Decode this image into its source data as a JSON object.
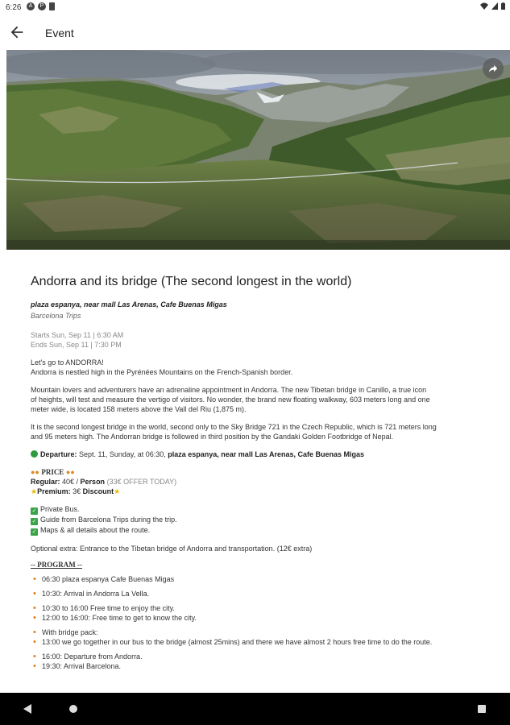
{
  "status": {
    "time": "6:26"
  },
  "app_bar": {
    "title": "Event"
  },
  "event": {
    "title": "Andorra and its bridge (The second longest in the world)",
    "venue": "plaza espanya, near mall Las Arenas, Cafe Buenas Migas",
    "organizer": "Barcelona Trips",
    "starts": "Starts Sun, Sep 11 | 6:30 AM",
    "ends": "Ends Sun, Sep 11 | 7:30 PM"
  },
  "description": {
    "intro_1": "Let's go to ANDORRA!",
    "intro_2": "Andorra is nestled high in the Pyrénées Mountains on the French-Spanish border.",
    "para_2a": "Mountain lovers and adventurers have an adrenaline appointment in Andorra. The new Tibetan bridge in Canillo, a true icon",
    "para_2b": "of heights, will test and measure the vertigo of visitors. No wonder, the brand new floating walkway, 603 meters long and one",
    "para_2c": "meter wide, is located 158 meters above the Vall del Riu (1,875 m).",
    "para_3a": "It is the second longest bridge in the world, second only to the Sky Bridge 721 in the Czech Republic, which is 721 meters long",
    "para_3b": "and 95 meters high. The Andorran bridge is followed in third position by the Gandaki Golden Footbridge of Nepal.",
    "departure_label": "Departure:",
    "departure_text": " Sept. 11, Sunday, at 06:30, ",
    "departure_place": "plaza espanya, near mall Las Arenas, Cafe Buenas Migas",
    "price_heading": "PRICE",
    "regular_label": "Regular:",
    "regular_value": " 40€ / ",
    "regular_person": "Person",
    "regular_offer": " (33€ OFFER TODAY)",
    "premium_label": "Premium:",
    "premium_value": " 3€ ",
    "premium_discount": "Discount",
    "included": [
      "Private Bus.",
      "Guide from Barcelona Trips during the trip.",
      "Maps & all details about the route."
    ],
    "optional_extra": "Optional extra:  Entrance to the Tibetan bridge of Andorra and transportation. (12€ extra)",
    "program_heading": "-- PROGRAM --",
    "program": [
      "06:30 plaza espanya Cafe Buenas Migas",
      "10:30: Arrival in Andorra La Vella.",
      "10:30 to 16:00 Free time to enjoy the city.",
      "12:00 to 16:00: Free time to get to know the city.",
      "With bridge pack:",
      "13:00 we go together in our bus to the bridge (almost 25mins) and there we have almost 2 hours free time to do the route.",
      "16:00: Departure from Andorra.",
      "19:30: Arrival Barcelona."
    ]
  },
  "icons": {
    "back": "arrow-back-icon",
    "share": "share-icon",
    "nav_back": "nav-back-icon",
    "nav_home": "nav-home-icon",
    "nav_recents": "nav-recents-icon"
  },
  "colors": {
    "accent_bullet": "#e07b1d",
    "green": "#2e9a3c"
  }
}
